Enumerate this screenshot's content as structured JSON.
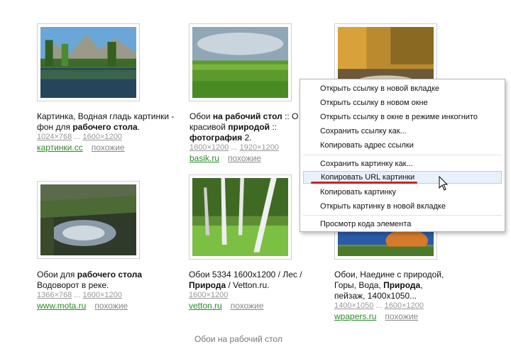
{
  "cards": [
    {
      "caption_html": "Картинка, Водная гладь картинки - фон для <b>рабочего стола</b>.",
      "size_a": "1024×768",
      "size_b": "1600×1200",
      "source": "картинки.cc",
      "similar": "похожие"
    },
    {
      "caption_html": "Обои <b>на рабочий стол</b> :: О красивой <b>природой</b> :: <b>фотография</b> 2.",
      "size_a": "1600×1200",
      "size_b": "1920×1200",
      "source": "basik.ru",
      "similar": "похожие"
    },
    {
      "caption_html": "",
      "size_a": "",
      "size_b": "",
      "source": "",
      "similar": ""
    },
    {
      "caption_html": "Обои для <b>рабочего стола</b> Водоворот в реке.",
      "size_a": "1366×768",
      "size_b": "1600×1200",
      "source": "www.mota.ru",
      "similar": "похожие"
    },
    {
      "caption_html": "Обои 5334 1600x1200 / Лес / <b>Природа</b> / Vetton.ru.",
      "size_a": "1600×1200",
      "size_b": "",
      "source": "vetton.ru",
      "similar": "похожие"
    },
    {
      "caption_html": "Обои, Наедине с природой, Горы, Вода, <b>Природа</b>, пейзаж, 1400x1050...",
      "size_a": "1400×1050",
      "size_b": "1600×1200",
      "source": "wpapers.ru",
      "similar": "похожие"
    }
  ],
  "footer": "Обои на рабочий стол",
  "context_menu": {
    "items": [
      "Открыть ссылку в новой вкладке",
      "Открыть ссылку в новом окне",
      "Открыть ссылку в окне в режиме инкогнито",
      "Сохранить ссылку как...",
      "Копировать адрес ссылки",
      "Сохранить картинку как...",
      "Копировать URL картинки",
      "Копировать картинку",
      "Открыть картинку в новой вкладке",
      "Просмотр кода элемента"
    ],
    "highlighted_index": 6
  },
  "colors": {
    "source_link": "#2a8a2a",
    "highlight_underline": "#cc2222"
  }
}
